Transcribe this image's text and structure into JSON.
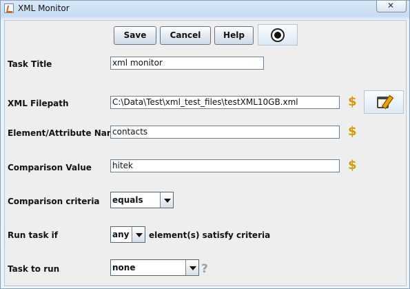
{
  "window": {
    "title": "XML Monitor"
  },
  "toolbar": {
    "save_label": "Save",
    "cancel_label": "Cancel",
    "help_label": "Help",
    "monitor_icon": "circle-target-icon"
  },
  "form": {
    "task_title": {
      "label": "Task Title",
      "value": "xml monitor"
    },
    "xml_filepath": {
      "label": "XML Filepath",
      "value": "C:\\Data\\Test\\xml_test_files\\testXML10GB.xml",
      "variable_icon": "dollar-icon",
      "edit_icon": "edit-notepad-icon"
    },
    "element_attribute_name": {
      "label": "Element/Attribute Name",
      "value": "contacts",
      "variable_icon": "dollar-icon"
    },
    "comparison_value": {
      "label": "Comparison Value",
      "value": "hitek",
      "variable_icon": "dollar-icon"
    },
    "comparison_criteria": {
      "label": "Comparison criteria",
      "selected": "equals"
    },
    "run_task_if": {
      "label": "Run task if",
      "selected": "any",
      "suffix": "element(s) satisfy criteria"
    },
    "task_to_run": {
      "label": "Task to run",
      "selected": "none",
      "help_icon": "question-icon",
      "help_symbol": "?"
    }
  },
  "colors": {
    "accent_border": "#6f7f8f",
    "dollar_icon": "#d59a00",
    "window_background": "#eeeeee"
  }
}
